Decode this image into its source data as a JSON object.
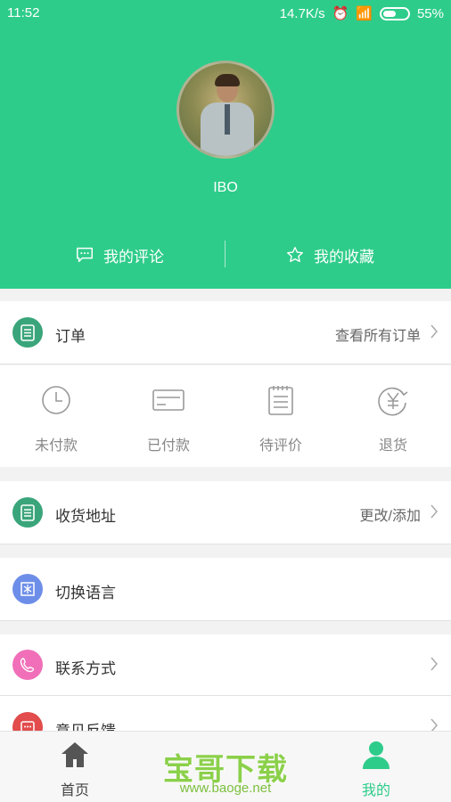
{
  "status_bar": {
    "time": "11:52",
    "speed": "14.7K/s",
    "battery": "55%",
    "battery_level": 0.55
  },
  "profile": {
    "username": "IBO",
    "my_comments": "我的评论",
    "my_favorites": "我的收藏"
  },
  "orders": {
    "title": "订单",
    "view_all": "查看所有订单",
    "tabs": [
      {
        "label": "未付款",
        "icon": "clock-icon"
      },
      {
        "label": "已付款",
        "icon": "card-icon"
      },
      {
        "label": "待评价",
        "icon": "notepad-icon"
      },
      {
        "label": "退货",
        "icon": "yen-refund-icon"
      }
    ]
  },
  "address": {
    "title": "收货地址",
    "action": "更改/添加"
  },
  "language": {
    "title": "切换语言"
  },
  "contact": {
    "title": "联系方式"
  },
  "feedback": {
    "title": "意见反馈"
  },
  "nav": {
    "home": "首页",
    "mine": "我的"
  },
  "watermark": {
    "title": "宝哥下载",
    "url": "www.baoge.net"
  },
  "colors": {
    "accent": "#2ecc8a",
    "address_icon": "#3aa57a",
    "language_icon": "#6d8ee8",
    "contact_icon": "#f06fb8",
    "feedback_icon": "#e24c4c"
  }
}
